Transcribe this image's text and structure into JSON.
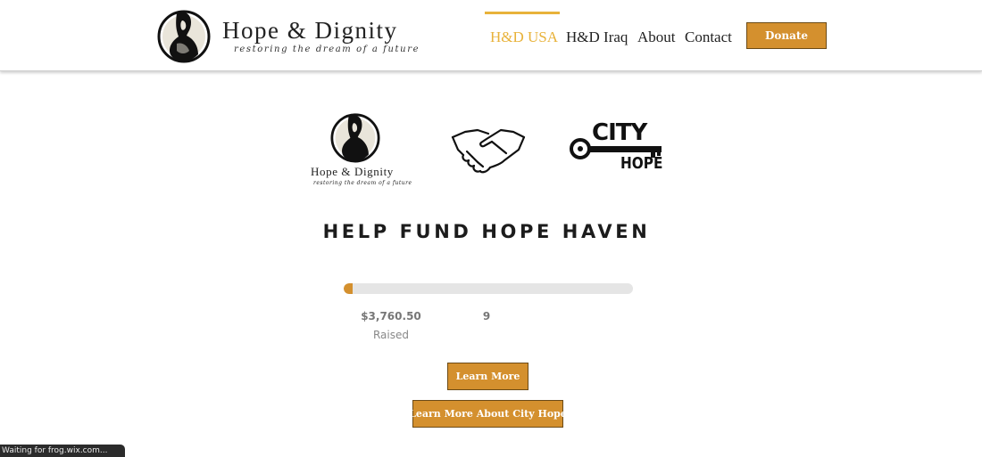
{
  "brand": {
    "name": "Hope & Dignity",
    "tagline": "restoring the dream of a future"
  },
  "nav": {
    "items": [
      {
        "label": "H&D USA",
        "active": true
      },
      {
        "label": "H&D Iraq",
        "active": false
      },
      {
        "label": "About",
        "active": false
      },
      {
        "label": "Contact",
        "active": false
      }
    ],
    "donate_label": "Donate"
  },
  "partners": {
    "hd_name": "Hope & Dignity",
    "hd_tagline": "restoring the dream of a future",
    "handshake_icon": "handshake-icon",
    "city_word": "CITY",
    "hope_word": "HOPE"
  },
  "campaign": {
    "title": "HELP FUND HOPE HAVEN",
    "progress_percent": 3,
    "raised_amount": "$3,760.50",
    "raised_label": "Raised",
    "count": "9"
  },
  "buttons": {
    "learn_more": "Learn More",
    "learn_city_hope": "Learn More About City Hope"
  },
  "status_bar": {
    "text": "Waiting for frog.wix.com..."
  },
  "colors": {
    "accent": "#d4902e",
    "active_nav": "#e8b23a",
    "progress_track": "#e5e5e5"
  }
}
